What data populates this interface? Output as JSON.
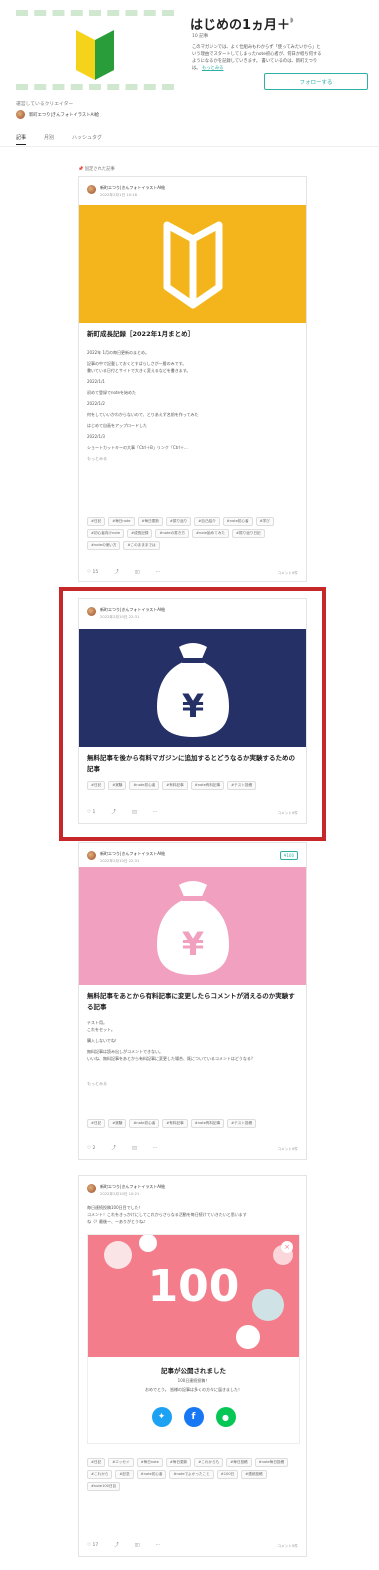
{
  "magazine": {
    "title": "はじめの1ヵ月＋",
    "article_count": "10 記事",
    "description": "このマガジンでは、よく仕組みもわからず「使ってみたいから」という理由でスタートしてしまったnote初心者が、何日か経ち何するようになるかを記録していきます。 書いているのは、新町えつり は。 ",
    "description_link": "もっとみる",
    "follow_label": "フォローする",
    "creator_label": "運営しているクリエイター",
    "creator_name": "新町エつり|きんフォトイラストAI絵",
    "tabs": [
      "記事",
      "月別",
      "ハッシュタグ"
    ],
    "pinned_label": "固定された記事"
  },
  "cards": [
    {
      "author": "新町エつり|きんフォトイラストAI絵",
      "date": "2022年2月1日 10:16",
      "title": "新町成長記録［2022年1月まとめ］",
      "body": [
        "2022年 1月の毎日更新のまとめ。",
        "記事の中で記載しておくとすばらしさが一層のみです。",
        "書いている日付とサイトで大きく変えるなどを書きます。",
        "2022/1/1",
        "初めて登録でnoteを始めた",
        "2022/1/2",
        "何をしていいかわからないので、とりあえず名前を作ってみた",
        "はじめて自画をアップロードした",
        "2022/1/3",
        "ショートカットキーの大事「Ctrl＋B」リンク「Ctrl＋..."
      ],
      "more": "もっとみる",
      "tags": [
        "#日記",
        "#毎日note",
        "#毎日更新",
        "#振り返り",
        "#自己紹介",
        "#note初心者",
        "#学び",
        "#初心者向けnote",
        "#成長記録",
        "#noteの書き方",
        "#note始めてみた",
        "#振り返り日記",
        "#noteの使い方",
        "#このまままでは"
      ],
      "likes": "15",
      "comment": "コメント0件"
    },
    {
      "author": "新町エつり|きんフォトイラストAI絵",
      "date": "2022年2月10日 22:31",
      "title": "無料記事を後から有料マガジンに追加するとどうなるか実験するための記事",
      "tags": [
        "#日記",
        "#実験",
        "#note初心者",
        "#有料記事",
        "#note有料記事",
        "#テスト投稿"
      ],
      "likes": "1",
      "comment": "コメント0件"
    },
    {
      "author": "新町エつり|きんフォトイラストAI絵",
      "date": "2022年2月10日 22:31",
      "price": "¥100",
      "title": "無料記事をあとから有料記事に変更したらコメントが消えるのか実験する記事",
      "body": [
        "テスト用。",
        "これをセット。",
        "購入しないでね！",
        "無料記事は読み出しがコメントできない。",
        "いいね、無料記事をあとから有料記事に変更した場合、既についているコメントはどうなる？"
      ],
      "more": "もっとみる",
      "tags": [
        "#日記",
        "#実験",
        "#note初心者",
        "#有料記事",
        "#note有料記事",
        "#テスト投稿"
      ],
      "likes": "2",
      "comment": "コメント0件"
    },
    {
      "author": "新町エつり|きんフォトイラストAI絵",
      "date": "2022年2月10日 10:21",
      "body": [
        "毎日連続投稿100日目でした！",
        "コメント！これをきっかけにしてこれからさらなる活動を毎日続けていきたいと思います",
        "ね（？最後ー、ーありがとうね♪"
      ],
      "notice_number": "100",
      "notice_title": "記事が公開されました",
      "notice_sub": "100日連続投稿！",
      "notice_desc": "おめでとう。 皆様の記事は多くの方々に届きました！",
      "tags": [
        "#日記",
        "#エッセイ",
        "#毎日note",
        "#毎日更新",
        "#これからも",
        "#毎日投稿",
        "#note毎日投稿",
        "#これから",
        "#記念",
        "#note初心者",
        "#noteでよかったこと",
        "#100日",
        "#連続投稿",
        "#note100日目"
      ],
      "likes": "17",
      "comment": "コメント0件"
    }
  ],
  "colors": {
    "accent": "#2fb0a5",
    "highlight": "#c6282a",
    "yellow": "#f3b51b",
    "navy": "#243066",
    "pink": "#f2a0c0",
    "notice_pink": "#f47d8b"
  }
}
